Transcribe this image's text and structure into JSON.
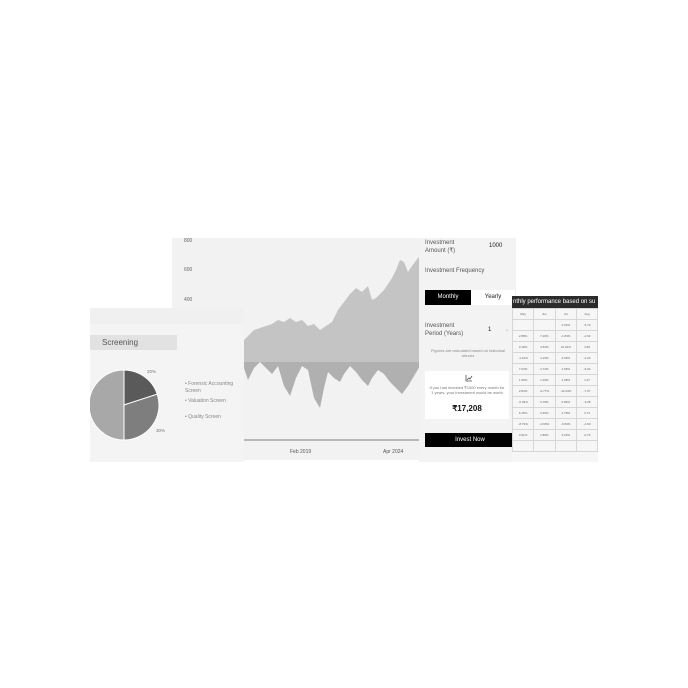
{
  "chart": {
    "y_ticks": [
      "800",
      "600",
      "400"
    ],
    "x_ticks": [
      "Feb 2019",
      "Apr 2024"
    ],
    "colors": {
      "line_fill": "#bdbdbd",
      "drawdown_fill": "#b5b5b5",
      "axis": "#555555"
    }
  },
  "calculator": {
    "investment_amount_label": "Investment Amount (₹)",
    "investment_amount_value": "1000",
    "frequency_label": "Investment Frequency",
    "frequency_options": [
      "Monthly",
      "Yearly"
    ],
    "frequency_selected": "Monthly",
    "period_label": "Investment Period (Years)",
    "period_value": "1",
    "note": "Figures are calculated based on historical returns",
    "result_text": "If you had invested ₹1000 every month for 1 years, your investment would be worth",
    "result_value": "₹17,208",
    "cta": "Invest Now"
  },
  "table": {
    "title": "nthly performance based on su",
    "headers": [
      "May",
      "Jun",
      "Jul",
      "Aug"
    ],
    "rows": [
      [
        "",
        "",
        "4.33%",
        "-5.70"
      ],
      [
        "2.88%",
        "7.20%",
        "-1.83%",
        "-2.93"
      ],
      [
        "0.18%",
        "4.53%",
        "10.22%",
        "4.59"
      ],
      [
        "-1.16%",
        "4.15%",
        "3.69%",
        "-2.20"
      ],
      [
        "7.04%",
        "2.72%",
        "4.99%",
        "-6.02"
      ],
      [
        "1.96%",
        "1.39%",
        "1.98%",
        "1.27"
      ],
      [
        "2.84%",
        "-0.77%",
        "-11.94%",
        "-7.07"
      ],
      [
        "-0.49%",
        "6.78%",
        "0.86%",
        "-3.28"
      ],
      [
        "6.15%",
        "3.30%",
        "4.78%",
        "3.73"
      ],
      [
        "-8.73%",
        "-0.66%",
        "-6.59%",
        "-4.60"
      ],
      [
        "3.91%",
        "1.86%",
        "3.63%",
        "-0.73"
      ],
      [
        "",
        "",
        "",
        ""
      ]
    ]
  },
  "screening": {
    "title": "Screening",
    "legend": [
      "Forensic Accounting Screen",
      "Valuation Screen",
      "Quality Screen"
    ],
    "percent_labels": [
      "20%",
      "30%"
    ],
    "slices": [
      {
        "label": "Forensic Accounting Screen",
        "value": 20,
        "color": "#5a5a5a"
      },
      {
        "label": "Valuation Screen",
        "value": 30,
        "color": "#7e7e7e"
      },
      {
        "label": "Quality Screen",
        "value": 50,
        "color": "#a8a8a8"
      }
    ]
  }
}
